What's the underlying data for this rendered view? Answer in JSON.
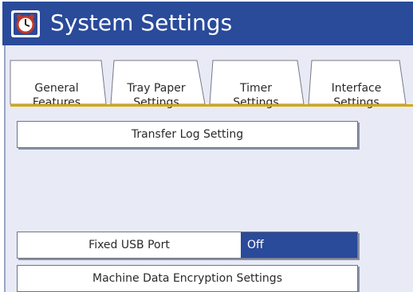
{
  "window": {
    "title": "System Settings",
    "icon": "clock-settings-icon"
  },
  "tabs": [
    {
      "label": "General\nFeatures"
    },
    {
      "label": "Tray Paper\nSettings"
    },
    {
      "label": "Timer\nSettings"
    },
    {
      "label": "Interface\nSettings"
    }
  ],
  "buttons": {
    "transfer_log": "Transfer Log Setting",
    "fixed_usb_port": "Fixed USB Port",
    "fixed_usb_port_value": "Off",
    "machine_data_encryption": "Machine Data Encryption Settings"
  },
  "colors": {
    "title_bar": "#2a4a9a",
    "accent_line": "#d4a60a",
    "panel": "#e8ebf6",
    "selected_value": "#2a4a9a"
  }
}
